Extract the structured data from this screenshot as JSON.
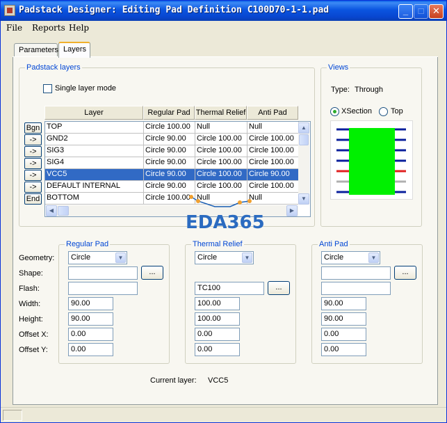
{
  "window": {
    "title": "Padstack Designer: Editing Pad Definition C100D70-1-1.pad"
  },
  "title_buttons": {
    "minimize": "_",
    "maximize": "□",
    "close": "✕"
  },
  "menu": {
    "file": "File",
    "reports": "Reports",
    "help": "Help"
  },
  "tabs": {
    "parameters": "Parameters",
    "layers": "Layers"
  },
  "padstack_layers": {
    "group_label": "Padstack layers",
    "single_layer_mode": "Single layer mode",
    "headers": [
      "Layer",
      "Regular Pad",
      "Thermal Relief",
      "Anti Pad"
    ],
    "row_buttons": [
      "Bgn",
      "->",
      "->",
      "->",
      "->",
      "->",
      "End"
    ],
    "rows": [
      [
        "TOP",
        "Circle 100.00",
        "Null",
        "Null"
      ],
      [
        "GND2",
        "Circle 90.00",
        "Circle 100.00",
        "Circle 100.00"
      ],
      [
        "SIG3",
        "Circle 90.00",
        "Circle 100.00",
        "Circle 100.00"
      ],
      [
        "SIG4",
        "Circle 90.00",
        "Circle 100.00",
        "Circle 100.00"
      ],
      [
        "VCC5",
        "Circle 90.00",
        "Circle 100.00",
        "Circle 90.00"
      ],
      [
        "DEFAULT INTERNAL",
        "Circle 90.00",
        "Circle 100.00",
        "Circle 100.00"
      ],
      [
        "BOTTOM",
        "Circle 100.00",
        "Null",
        "Null"
      ]
    ],
    "selected_row": 4
  },
  "views": {
    "group_label": "Views",
    "type_label": "Type:",
    "type_value": "Through",
    "xsection": "XSection",
    "top": "Top",
    "selected": "xsection",
    "colors": {
      "pad": "#00f000",
      "layer": "#0a1f9c",
      "highlight": "#e02020",
      "other": "#b0b0b0"
    }
  },
  "watermark": "EDA365",
  "form_labels": {
    "geometry": "Geometry:",
    "shape": "Shape:",
    "flash": "Flash:",
    "width": "Width:",
    "height": "Height:",
    "offset_x": "Offset X:",
    "offset_y": "Offset Y:"
  },
  "regular_pad": {
    "label": "Regular Pad",
    "geometry": "Circle",
    "shape": "",
    "flash": "",
    "width": "90.00",
    "height": "90.00",
    "offset_x": "0.00",
    "offset_y": "0.00"
  },
  "thermal_relief": {
    "label": "Thermal Relief",
    "geometry": "Circle",
    "flash": "TC100",
    "width": "100.00",
    "height": "100.00",
    "offset_x": "0.00",
    "offset_y": "0.00"
  },
  "anti_pad": {
    "label": "Anti Pad",
    "geometry": "Circle",
    "shape": "",
    "flash": "",
    "width": "90.00",
    "height": "90.00",
    "offset_x": "0.00",
    "offset_y": "0.00"
  },
  "browse_label": "...",
  "current_layer": {
    "label": "Current layer:",
    "value": "VCC5"
  }
}
